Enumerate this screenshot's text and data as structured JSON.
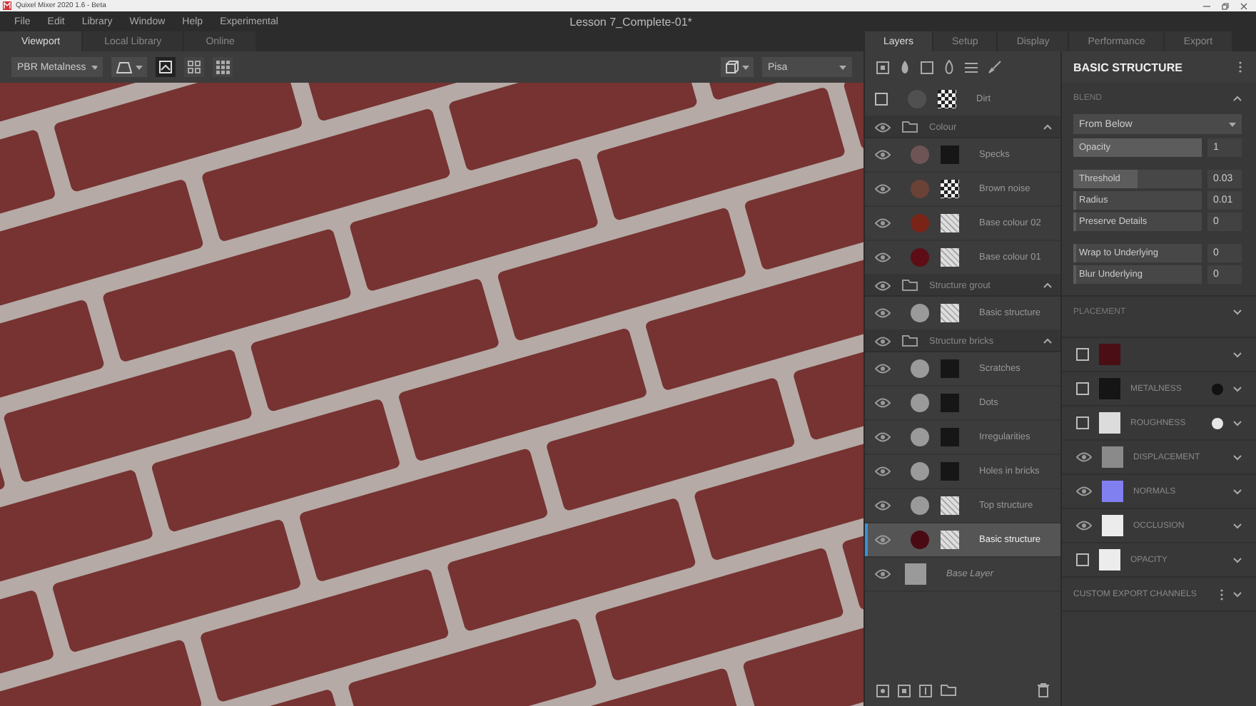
{
  "window": {
    "app_title": "Quixel Mixer 2020 1.6 - Beta",
    "title": "Lesson 7_Complete-01*"
  },
  "menu": [
    "File",
    "Edit",
    "Library",
    "Window",
    "Help",
    "Experimental"
  ],
  "view_tabs": [
    {
      "label": "Viewport",
      "selected": true
    },
    {
      "label": "Local Library",
      "selected": false
    },
    {
      "label": "Online",
      "selected": false
    }
  ],
  "toolbar": {
    "shading_mode": "PBR Metalness",
    "environment": "Pisa",
    "views": [
      {
        "kind": "single",
        "selected": true
      },
      {
        "kind": "quad",
        "selected": false
      },
      {
        "kind": "grid",
        "selected": false
      }
    ]
  },
  "panel_tabs": [
    {
      "label": "Layers",
      "selected": true
    },
    {
      "label": "Setup",
      "selected": false
    },
    {
      "label": "Display",
      "selected": false
    },
    {
      "label": "Performance",
      "selected": false
    },
    {
      "label": "Export",
      "selected": false
    }
  ],
  "layers": [
    {
      "kind": "layer",
      "name": "Dirt",
      "visible": false,
      "selected": false,
      "color": "#505050",
      "thumbnail": {
        "kind": "noise"
      }
    },
    {
      "kind": "group",
      "name": "Colour",
      "visible": true,
      "expanded": true,
      "children": [
        {
          "name": "Specks",
          "visible": true,
          "selected": false,
          "color": "#6e5454",
          "thumbnail": {
            "kind": "dark"
          }
        },
        {
          "name": "Brown noise",
          "visible": true,
          "selected": false,
          "color": "#6a4236",
          "thumbnail": {
            "kind": "noise"
          }
        },
        {
          "name": "Base colour 02",
          "visible": true,
          "selected": false,
          "color": "#7a2418",
          "thumbnail": {
            "kind": "light"
          }
        },
        {
          "name": "Base colour 01",
          "visible": true,
          "selected": false,
          "color": "#5e0d16",
          "thumbnail": {
            "kind": "light"
          }
        }
      ]
    },
    {
      "kind": "group",
      "name": "Structure grout",
      "visible": true,
      "expanded": true,
      "children": [
        {
          "name": "Basic structure",
          "visible": true,
          "selected": false,
          "color": "#9a9a9a",
          "thumbnail": {
            "kind": "light"
          }
        }
      ]
    },
    {
      "kind": "group",
      "name": "Structure bricks",
      "visible": true,
      "expanded": true,
      "children": [
        {
          "name": "Scratches",
          "visible": true,
          "selected": false,
          "color": "#9a9a9a",
          "thumbnail": {
            "kind": "dark"
          }
        },
        {
          "name": "Dots",
          "visible": true,
          "selected": false,
          "color": "#9a9a9a",
          "thumbnail": {
            "kind": "dark"
          }
        },
        {
          "name": "Irregularities",
          "visible": true,
          "selected": false,
          "color": "#9a9a9a",
          "thumbnail": {
            "kind": "dark"
          }
        },
        {
          "name": "Holes in bricks",
          "visible": true,
          "selected": false,
          "color": "#9a9a9a",
          "thumbnail": {
            "kind": "dark"
          }
        },
        {
          "name": "Top structure",
          "visible": true,
          "selected": false,
          "color": "#9a9a9a",
          "thumbnail": {
            "kind": "light"
          }
        },
        {
          "name": "Basic structure",
          "visible": true,
          "selected": true,
          "color": "#4a0a14",
          "thumbnail": {
            "kind": "light"
          }
        }
      ]
    },
    {
      "kind": "base",
      "name": "Base Layer",
      "visible": true,
      "selected": false,
      "color": "#9a9a9a"
    }
  ],
  "properties": {
    "title": "BASIC STRUCTURE",
    "blend": {
      "heading": "BLEND",
      "expanded": true,
      "mode": "From Below",
      "param_groups": [
        [
          {
            "label": "Opacity",
            "value": "1",
            "level": 1
          }
        ],
        [
          {
            "label": "Threshold",
            "value": "0.03",
            "level": 0.5
          },
          {
            "label": "Radius",
            "value": "0.01",
            "level": 0.01
          },
          {
            "label": "Preserve Details",
            "value": "0",
            "level": 0
          }
        ],
        [
          {
            "label": "Wrap to Underlying",
            "value": "0",
            "level": 0
          },
          {
            "label": "Blur Underlying",
            "value": "0",
            "level": 0
          }
        ]
      ]
    },
    "placement": {
      "heading": "PLACEMENT",
      "expanded": false
    },
    "channels": [
      {
        "visible": false,
        "color": "#4a0e14"
      },
      {
        "label": "METALNESS",
        "visible": false,
        "color": "#151515",
        "value_dot": {
          "color": "#111111"
        }
      },
      {
        "label": "ROUGHNESS",
        "visible": false,
        "color": "#dcdcdc",
        "value_dot": {
          "color": "#e6e6e6"
        }
      },
      {
        "label": "DISPLACEMENT",
        "visible": true,
        "color": "#8a8a8a"
      },
      {
        "label": "NORMALS",
        "visible": true,
        "color": "#8080f0"
      },
      {
        "label": "OCCLUSION",
        "visible": true,
        "color": "#ececec"
      },
      {
        "label": "OPACITY",
        "visible": false,
        "color": "#ececec"
      }
    ],
    "custom_export": "CUSTOM EXPORT CHANNELS"
  }
}
